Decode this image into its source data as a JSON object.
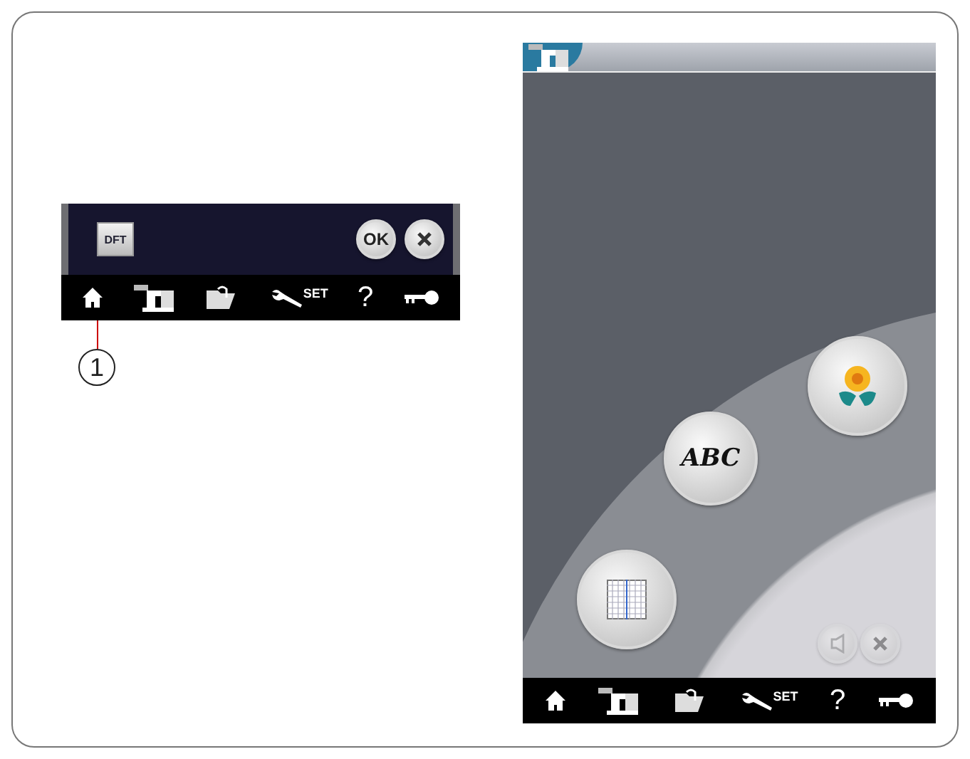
{
  "panel": {
    "default_button": "DFT",
    "ok_button": "OK",
    "cancel_button": {
      "kind": "close"
    }
  },
  "toolbar_left": [
    {
      "kind": "home"
    },
    {
      "kind": "machine"
    },
    {
      "kind": "folder"
    },
    {
      "kind": "settings",
      "label": "SET"
    },
    {
      "kind": "help",
      "label": "?"
    },
    {
      "kind": "key"
    }
  ],
  "callout": {
    "number": "1"
  },
  "screen": {
    "title_icon": {
      "kind": "machine"
    },
    "pattern_buttons": [
      {
        "kind": "flower"
      },
      {
        "kind": "letters",
        "label": "ABC"
      },
      {
        "kind": "grid"
      }
    ],
    "small_buttons": [
      {
        "kind": "sound",
        "disabled": true
      },
      {
        "kind": "close",
        "disabled": true
      }
    ]
  },
  "toolbar_right": [
    {
      "kind": "home"
    },
    {
      "kind": "machine"
    },
    {
      "kind": "folder"
    },
    {
      "kind": "settings",
      "label": "SET"
    },
    {
      "kind": "help",
      "label": "?"
    },
    {
      "kind": "key"
    }
  ]
}
